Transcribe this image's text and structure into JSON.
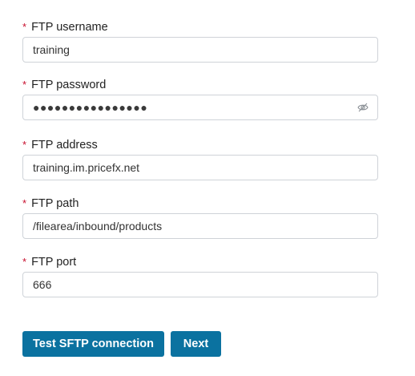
{
  "form": {
    "username": {
      "required_mark": "*",
      "label": "FTP username",
      "value": "training"
    },
    "password": {
      "required_mark": "*",
      "label": "FTP password",
      "masked_value": "●●●●●●●●●●●●●●●●",
      "toggle_icon": "eye-slash-icon"
    },
    "address": {
      "required_mark": "*",
      "label": "FTP address",
      "value": "training.im.pricefx.net"
    },
    "path": {
      "required_mark": "*",
      "label": "FTP path",
      "value": "/filearea/inbound/products"
    },
    "port": {
      "required_mark": "*",
      "label": "FTP port",
      "value": "666"
    }
  },
  "actions": {
    "test_label": "Test SFTP connection",
    "next_label": "Next"
  },
  "colors": {
    "required": "#c8102e",
    "primary_button": "#0b72a0",
    "input_border": "#cfd3d8"
  }
}
